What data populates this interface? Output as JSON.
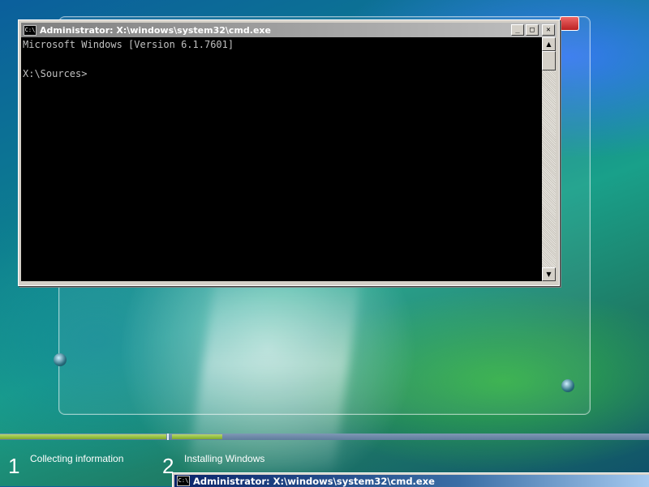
{
  "cmd_window": {
    "title": "Administrator: X:\\windows\\system32\\cmd.exe",
    "icon_text": "C:\\",
    "buttons": {
      "minimize": "_",
      "maximize": "□",
      "close": "✕"
    },
    "console_lines": [
      "Microsoft Windows [Version 6.1.7601]",
      "",
      "X:\\Sources>"
    ],
    "scroll_up": "▲",
    "scroll_down": "▼"
  },
  "setup": {
    "steps": [
      {
        "number": "1",
        "label": "Collecting information"
      },
      {
        "number": "2",
        "label": "Installing Windows"
      }
    ]
  },
  "cmd_window_2": {
    "title": "Administrator: X:\\windows\\system32\\cmd.exe",
    "icon_text": "C:\\"
  },
  "colors": {
    "titlebar_active": "#0a246a",
    "progress_green": "#8fbf3a"
  }
}
